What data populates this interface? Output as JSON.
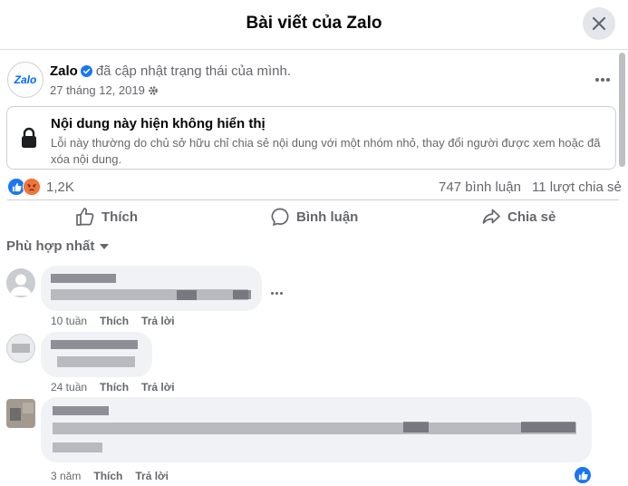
{
  "dialog": {
    "title": "Bài viết của Zalo"
  },
  "post": {
    "author": "Zalo",
    "logo_text": "Zalo",
    "status": "đã cập nhật trạng thái của mình.",
    "date": "27 tháng 12, 2019",
    "notice": {
      "title": "Nội dung này hiện không hiển thị",
      "body": "Lỗi này thường do chủ sở hữu chỉ chia sẻ nội dung với một nhóm nhỏ, thay đổi người được xem hoặc đã xóa nội dung."
    },
    "reaction_count": "1,2K",
    "comment_count": "747 bình luận",
    "share_count": "11 lượt chia sẻ"
  },
  "actions": {
    "like": "Thích",
    "comment": "Bình luận",
    "share": "Chia sẻ"
  },
  "filter_label": "Phù hợp nhất",
  "comments": [
    {
      "time": "10 tuần",
      "like": "Thích",
      "reply": "Trả lời"
    },
    {
      "time": "24 tuần",
      "like": "Thích",
      "reply": "Trả lời"
    },
    {
      "time": "3 năm",
      "like": "Thích",
      "reply": "Trả lời"
    }
  ],
  "colors": {
    "accent": "#1877f2",
    "text_secondary": "#65676b",
    "bubble": "#f0f2f5",
    "angry": "#f0743c"
  },
  "icons": [
    "close-icon",
    "verified-icon",
    "gear-icon",
    "more-icon",
    "lock-icon",
    "like-reaction-icon",
    "angry-reaction-icon",
    "thumb-icon",
    "comment-icon",
    "share-icon",
    "caret-down-icon"
  ]
}
